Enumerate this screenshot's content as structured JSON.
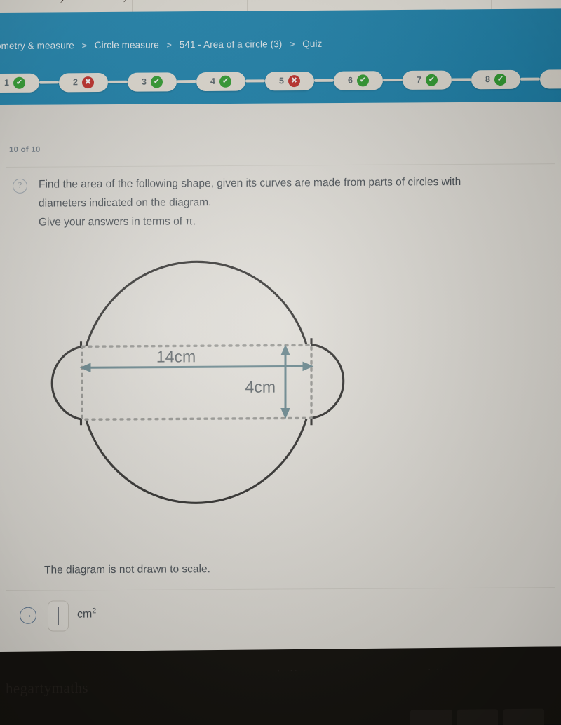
{
  "browser": {
    "tab_glyphs": [
      ")",
      ")"
    ]
  },
  "header": {
    "breadcrumb": [
      {
        "label": "ometry & measure"
      },
      {
        "label": "Circle measure"
      },
      {
        "label": "541 - Area of a circle (3)"
      },
      {
        "label": "Quiz"
      }
    ],
    "separator": ">",
    "accent_color": "#2189b4",
    "progress": [
      {
        "num": "1",
        "status": "correct"
      },
      {
        "num": "2",
        "status": "wrong"
      },
      {
        "num": "3",
        "status": "correct"
      },
      {
        "num": "4",
        "status": "correct"
      },
      {
        "num": "5",
        "status": "wrong"
      },
      {
        "num": "6",
        "status": "correct"
      },
      {
        "num": "7",
        "status": "correct"
      },
      {
        "num": "8",
        "status": "correct"
      },
      {
        "num": "",
        "status": "none"
      }
    ],
    "correct_glyph": "✔",
    "wrong_glyph": "✖",
    "correct_color": "#35a434",
    "wrong_color": "#c9322d"
  },
  "quiz": {
    "counter": "10 of 10",
    "help_icon_glyph": "?",
    "question_lines": [
      "Find the area of the following shape, given its curves are made from parts of circles with",
      "diameters indicated on the diagram.",
      "Give your answers in terms of π."
    ],
    "scale_note": "The diagram is not drawn to scale.",
    "answer": {
      "submit_glyph": "→",
      "value": "",
      "unit": "cm",
      "unit_exponent": "2"
    }
  },
  "diagram": {
    "type": "geometry-figure",
    "description": "Large oval with two small semicircular bulges on the left and right sides, overlaid by a dotted rectangle band",
    "labels": [
      {
        "text": "14cm",
        "meaning": "horizontal dimension of the dotted band"
      },
      {
        "text": "4cm",
        "meaning": "vertical dimension of the dotted band"
      }
    ],
    "outline_color": "#1b1a18",
    "dimension_color": "#55777f",
    "dotted_color": "#8b8b86"
  },
  "bezel": {
    "watermark": "hegartymaths",
    "hint_left": "·· ·· ·",
    "hint_right": "· ··"
  }
}
